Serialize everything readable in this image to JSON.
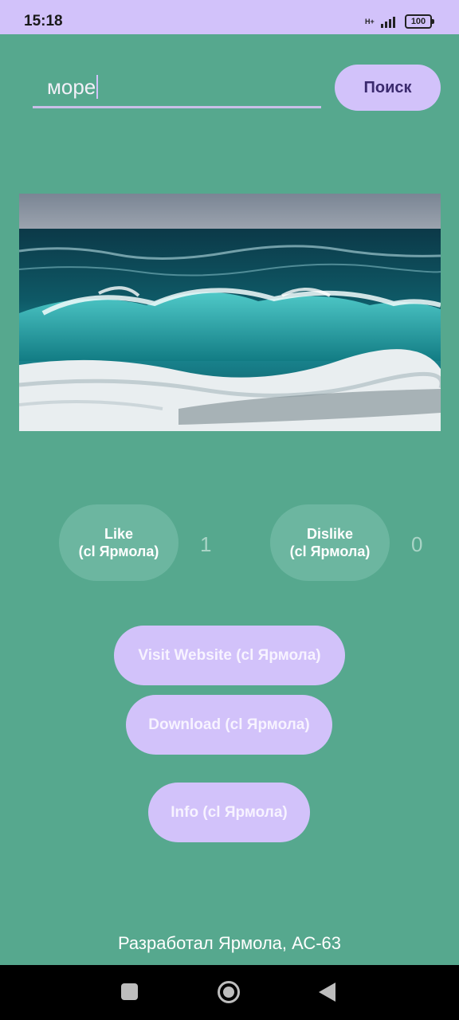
{
  "status_bar": {
    "time": "15:18",
    "network": "H+",
    "battery": "100"
  },
  "search": {
    "value": "море",
    "button_label": "Поиск"
  },
  "reactions": {
    "like_line1": "Like",
    "like_line2": "(cl Ярмола)",
    "like_count": "1",
    "dislike_line1": "Dislike",
    "dislike_line2": "(cl Ярмола)",
    "dislike_count": "0"
  },
  "actions": {
    "visit_label": "Visit Website (cl Ярмола)",
    "download_label": "Download (cl Ярмола)",
    "info_label": "Info (cl Ярмола)"
  },
  "footer": {
    "text": "Разработал Ярмола, АС-63"
  },
  "colors": {
    "background": "#56A88E",
    "accent": "#D2C2FA",
    "reaction_button": "#6CB6A0"
  },
  "icons": {
    "nav_recents": "square-icon",
    "nav_home": "home-circle-icon",
    "nav_back": "back-triangle-icon"
  }
}
